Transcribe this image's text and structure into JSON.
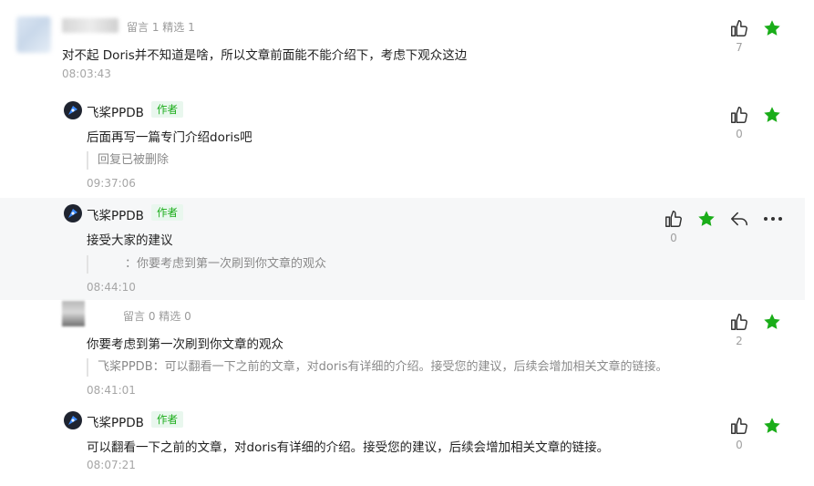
{
  "comments": [
    {
      "meta": "留言 1 精选 1",
      "text": "对不起 Doris并不知道是啥，所以文章前面能不能介绍下，考虑下观众这边",
      "time": "08:03:43",
      "likes": "7"
    },
    {
      "author": "飞桨PPDB",
      "badge": "作者",
      "text": "后面再写一篇专门介绍doris吧",
      "quote": "回复已被删除",
      "time": "09:37:06",
      "likes": "0"
    },
    {
      "author": "飞桨PPDB",
      "badge": "作者",
      "text": "接受大家的建议",
      "quote": "：你要考虑到第一次刷到你文章的观众",
      "time": "08:44:10",
      "likes": "0"
    },
    {
      "meta": "留言 0 精选 0",
      "text": "你要考虑到第一次刷到你文章的观众",
      "quote": "飞桨PPDB：可以翻看一下之前的文章，对doris有详细的介绍。接受您的建议，后续会增加相关文章的链接。",
      "time": "08:41:01",
      "likes": "2"
    },
    {
      "author": "飞桨PPDB",
      "badge": "作者",
      "text": "可以翻看一下之前的文章，对doris有详细的介绍。接受您的建议，后续会增加相关文章的链接。",
      "time": "08:07:21",
      "likes": "0"
    }
  ],
  "colors": {
    "star": "#1aad19",
    "badge_bg": "#e9f7ee",
    "hover_bg": "#f6f7f8"
  },
  "icons": [
    "thumbs-up-icon",
    "star-icon",
    "reply-icon",
    "more-icon"
  ]
}
